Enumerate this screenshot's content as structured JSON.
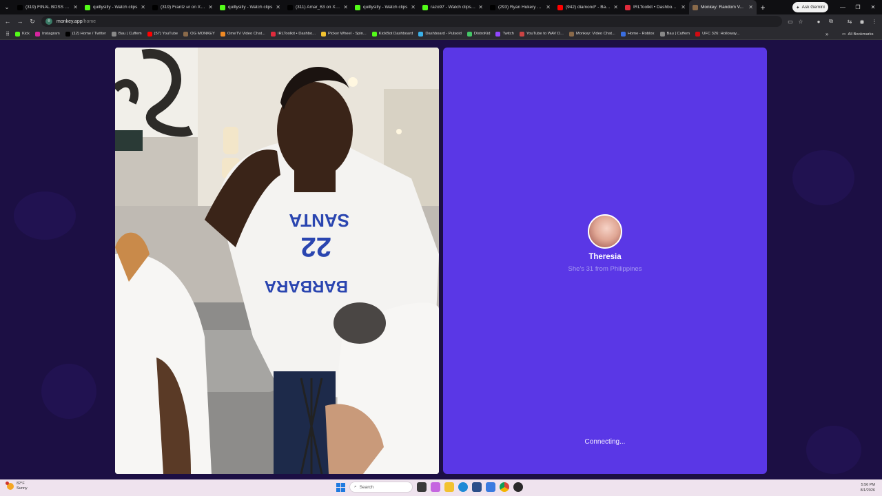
{
  "browser": {
    "tabs": [
      {
        "title": "(319) FINAL BOSS EN...",
        "icon": "x-icon",
        "color": "#000000"
      },
      {
        "title": "quillysilly - Watch clips",
        "icon": "kick-icon",
        "color": "#53fc18"
      },
      {
        "title": "(319) Frantz нr on X: \"...",
        "icon": "x-icon",
        "color": "#000000"
      },
      {
        "title": "quillysilly - Watch clips",
        "icon": "kick-icon",
        "color": "#53fc18"
      },
      {
        "title": "(311) Amar_63 on X: \"...",
        "icon": "x-icon",
        "color": "#000000"
      },
      {
        "title": "quillysilly - Watch clips",
        "icon": "kick-icon",
        "color": "#53fc18"
      },
      {
        "title": "razo97 - Watch clips on...",
        "icon": "kick-icon",
        "color": "#53fc18"
      },
      {
        "title": "(293) Ryan Hukery on X...",
        "icon": "x-icon",
        "color": "#000000"
      },
      {
        "title": "(942) diamond* - Bada...",
        "icon": "youtube-icon",
        "color": "#ff0000"
      },
      {
        "title": "IRLToolkit • Dashboard",
        "icon": "irltoolkit-icon",
        "color": "#e02b3c"
      },
      {
        "title": "Monkey: Random V...",
        "icon": "monkey-icon",
        "color": "#8a6a4a",
        "active": true
      }
    ],
    "ask_gemini": "Ask Gemini",
    "url_host": "monkey.app",
    "url_path": "/home",
    "bookmarks": [
      {
        "label": "Kick",
        "color": "#53fc18"
      },
      {
        "label": "Instagram",
        "color": "#d6249f"
      },
      {
        "label": "(12) Home / Twitter",
        "color": "#000000"
      },
      {
        "label": "Bau | Cuffem",
        "color": "#888888"
      },
      {
        "label": "(57) YouTube",
        "color": "#ff0000"
      },
      {
        "label": "OG MONKEY",
        "color": "#8a6a4a"
      },
      {
        "label": "OmeTV Video Chat...",
        "color": "#f08a24"
      },
      {
        "label": "IRLToolkit • Dashbo...",
        "color": "#e02b3c"
      },
      {
        "label": "Picker Wheel - Spin...",
        "color": "#f2c230"
      },
      {
        "label": "KickBot Dashboard",
        "color": "#53fc18"
      },
      {
        "label": "Dashboard - Pulsoid",
        "color": "#3ab0e8"
      },
      {
        "label": "DistroKid",
        "color": "#44c767"
      },
      {
        "label": "Twitch",
        "color": "#9146ff"
      },
      {
        "label": "YouTube to WAV D...",
        "color": "#cc4444"
      },
      {
        "label": "Monkey: Video Chat...",
        "color": "#8a6a4a"
      },
      {
        "label": "Home - Roblox",
        "color": "#3a6ee0"
      },
      {
        "label": "Bau | Cuffem",
        "color": "#888888"
      },
      {
        "label": "UFC 326: Holloway...",
        "color": "#d20a11"
      }
    ],
    "all_bookmarks": "All Bookmarks"
  },
  "app": {
    "peer": {
      "name": "Theresia",
      "subtitle": "She's 31 from Philippines"
    },
    "status": "Connecting...",
    "panel_color": "#5a37e6",
    "background_color": "#1c0f44"
  },
  "taskbar": {
    "temperature": "82°F",
    "weather": "Sunny",
    "search_placeholder": "Search",
    "time": "5:56 PM",
    "date": "8/1/2026"
  }
}
